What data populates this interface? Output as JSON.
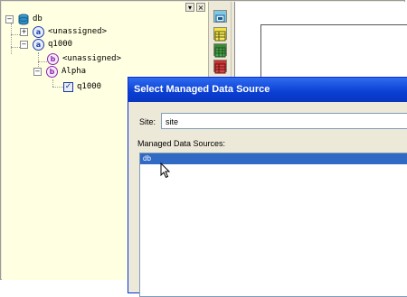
{
  "tree": {
    "controls": [
      "▾",
      "×"
    ],
    "nodes": [
      {
        "expander": "−",
        "icon": "database-icon",
        "label": "db"
      },
      {
        "expander": "+",
        "badge": "a",
        "label": "<unassigned>"
      },
      {
        "expander": "−",
        "badge": "a",
        "label": "q1000"
      },
      {
        "badge": "b",
        "label": "<unassigned>"
      },
      {
        "expander": "−",
        "badge": "b",
        "label": "Alpha"
      },
      {
        "icon": "checkbox-icon",
        "label": "q1000"
      }
    ]
  },
  "toolbar": {
    "buttons": [
      "view-icon",
      "table-icon",
      "grid-icon",
      "red-grid-icon"
    ]
  },
  "dialog": {
    "title": "Select Managed Data Source",
    "site_label": "Site:",
    "site_value": "site",
    "list_label": "Managed Data Sources:",
    "items": [
      "db"
    ],
    "selected_index": 0
  },
  "colors": {
    "tree_bg": "#ffffe1",
    "title_bar": "#0a3fd2",
    "selection": "#316ac5",
    "dialog_bg": "#ece9d8"
  }
}
